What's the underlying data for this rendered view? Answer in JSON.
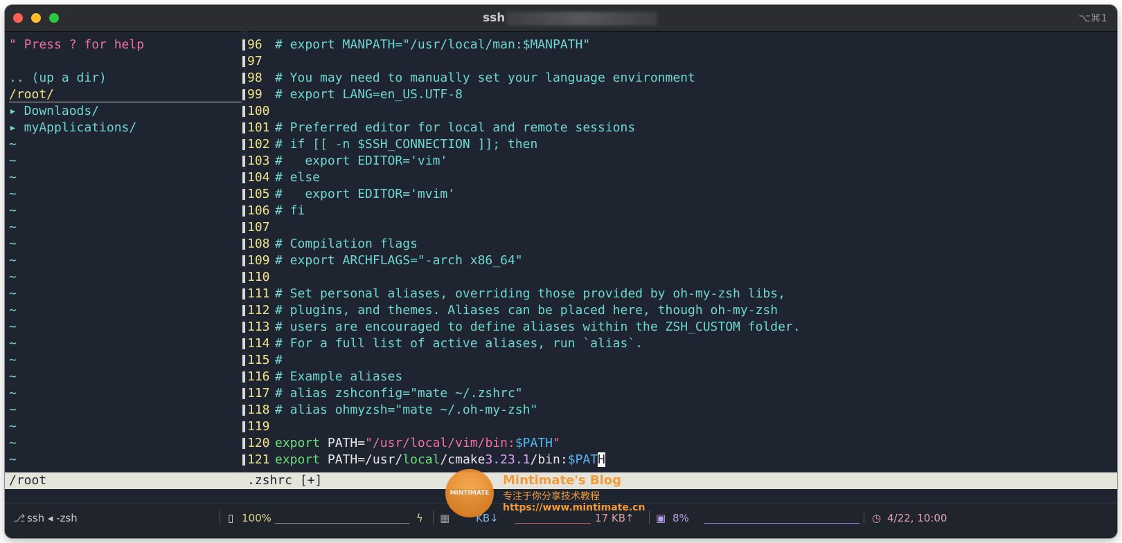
{
  "window": {
    "title": "ssh",
    "shortcut": "⌥⌘1"
  },
  "tree": {
    "help": "\" Press ? for help",
    "up_dir": ".. (up a dir)",
    "current": "/root/",
    "items": [
      "▸ Downlaods/",
      "▸ myApplications/"
    ],
    "tilde": "~"
  },
  "editor": {
    "lines": [
      {
        "n": "96",
        "t": "# export MANPATH=\"/usr/local/man:$MANPATH\""
      },
      {
        "n": "97",
        "t": ""
      },
      {
        "n": "98",
        "t": "# You may need to manually set your language environment"
      },
      {
        "n": "99",
        "t": "# export LANG=en_US.UTF-8"
      },
      {
        "n": "100",
        "t": ""
      },
      {
        "n": "101",
        "t": "# Preferred editor for local and remote sessions"
      },
      {
        "n": "102",
        "t": "# if [[ -n $SSH_CONNECTION ]]; then"
      },
      {
        "n": "103",
        "t": "#   export EDITOR='vim'"
      },
      {
        "n": "104",
        "t": "# else"
      },
      {
        "n": "105",
        "t": "#   export EDITOR='mvim'"
      },
      {
        "n": "106",
        "t": "# fi"
      },
      {
        "n": "107",
        "t": ""
      },
      {
        "n": "108",
        "t": "# Compilation flags"
      },
      {
        "n": "109",
        "t": "# export ARCHFLAGS=\"-arch x86_64\""
      },
      {
        "n": "110",
        "t": ""
      },
      {
        "n": "111",
        "t": "# Set personal aliases, overriding those provided by oh-my-zsh libs,"
      },
      {
        "n": "112",
        "t": "# plugins, and themes. Aliases can be placed here, though oh-my-zsh"
      },
      {
        "n": "113",
        "t": "# users are encouraged to define aliases within the ZSH_CUSTOM folder."
      },
      {
        "n": "114",
        "t": "# For a full list of active aliases, run `alias`."
      },
      {
        "n": "115",
        "t": "#"
      },
      {
        "n": "116",
        "t": "# Example aliases"
      },
      {
        "n": "117",
        "t": "# alias zshconfig=\"mate ~/.zshrc\""
      },
      {
        "n": "118",
        "t": "# alias ohmyzsh=\"mate ~/.oh-my-zsh\""
      },
      {
        "n": "119",
        "t": ""
      }
    ],
    "line120": {
      "n": "120",
      "kw": "export",
      "name": " PATH=",
      "str": "\"/usr/local/vim/bin:",
      "var": "$PATH",
      "end": "\""
    },
    "line121": {
      "n": "121",
      "kw": "export",
      "name": " PATH=/usr/",
      "local": "local",
      "mid": "/cmake",
      "ver": "3.23.1",
      "tail": "/bin:",
      "var": "$PAT",
      "cursor": "H"
    }
  },
  "statusline": {
    "left": "/root",
    "right": ".zshrc [+]"
  },
  "bottombar": {
    "session": "ssh ◂ -zsh",
    "battery": "100%",
    "net_down": "KB↓",
    "net_up": "17 KB↑",
    "cpu": "8%",
    "datetime": "4/22, 10:00"
  },
  "watermark": {
    "badge": "MINTIMATE",
    "title": "Mintimate's Blog",
    "subtitle": "专注于你分享技术教程",
    "url": "https://www.mintimate.cn"
  }
}
